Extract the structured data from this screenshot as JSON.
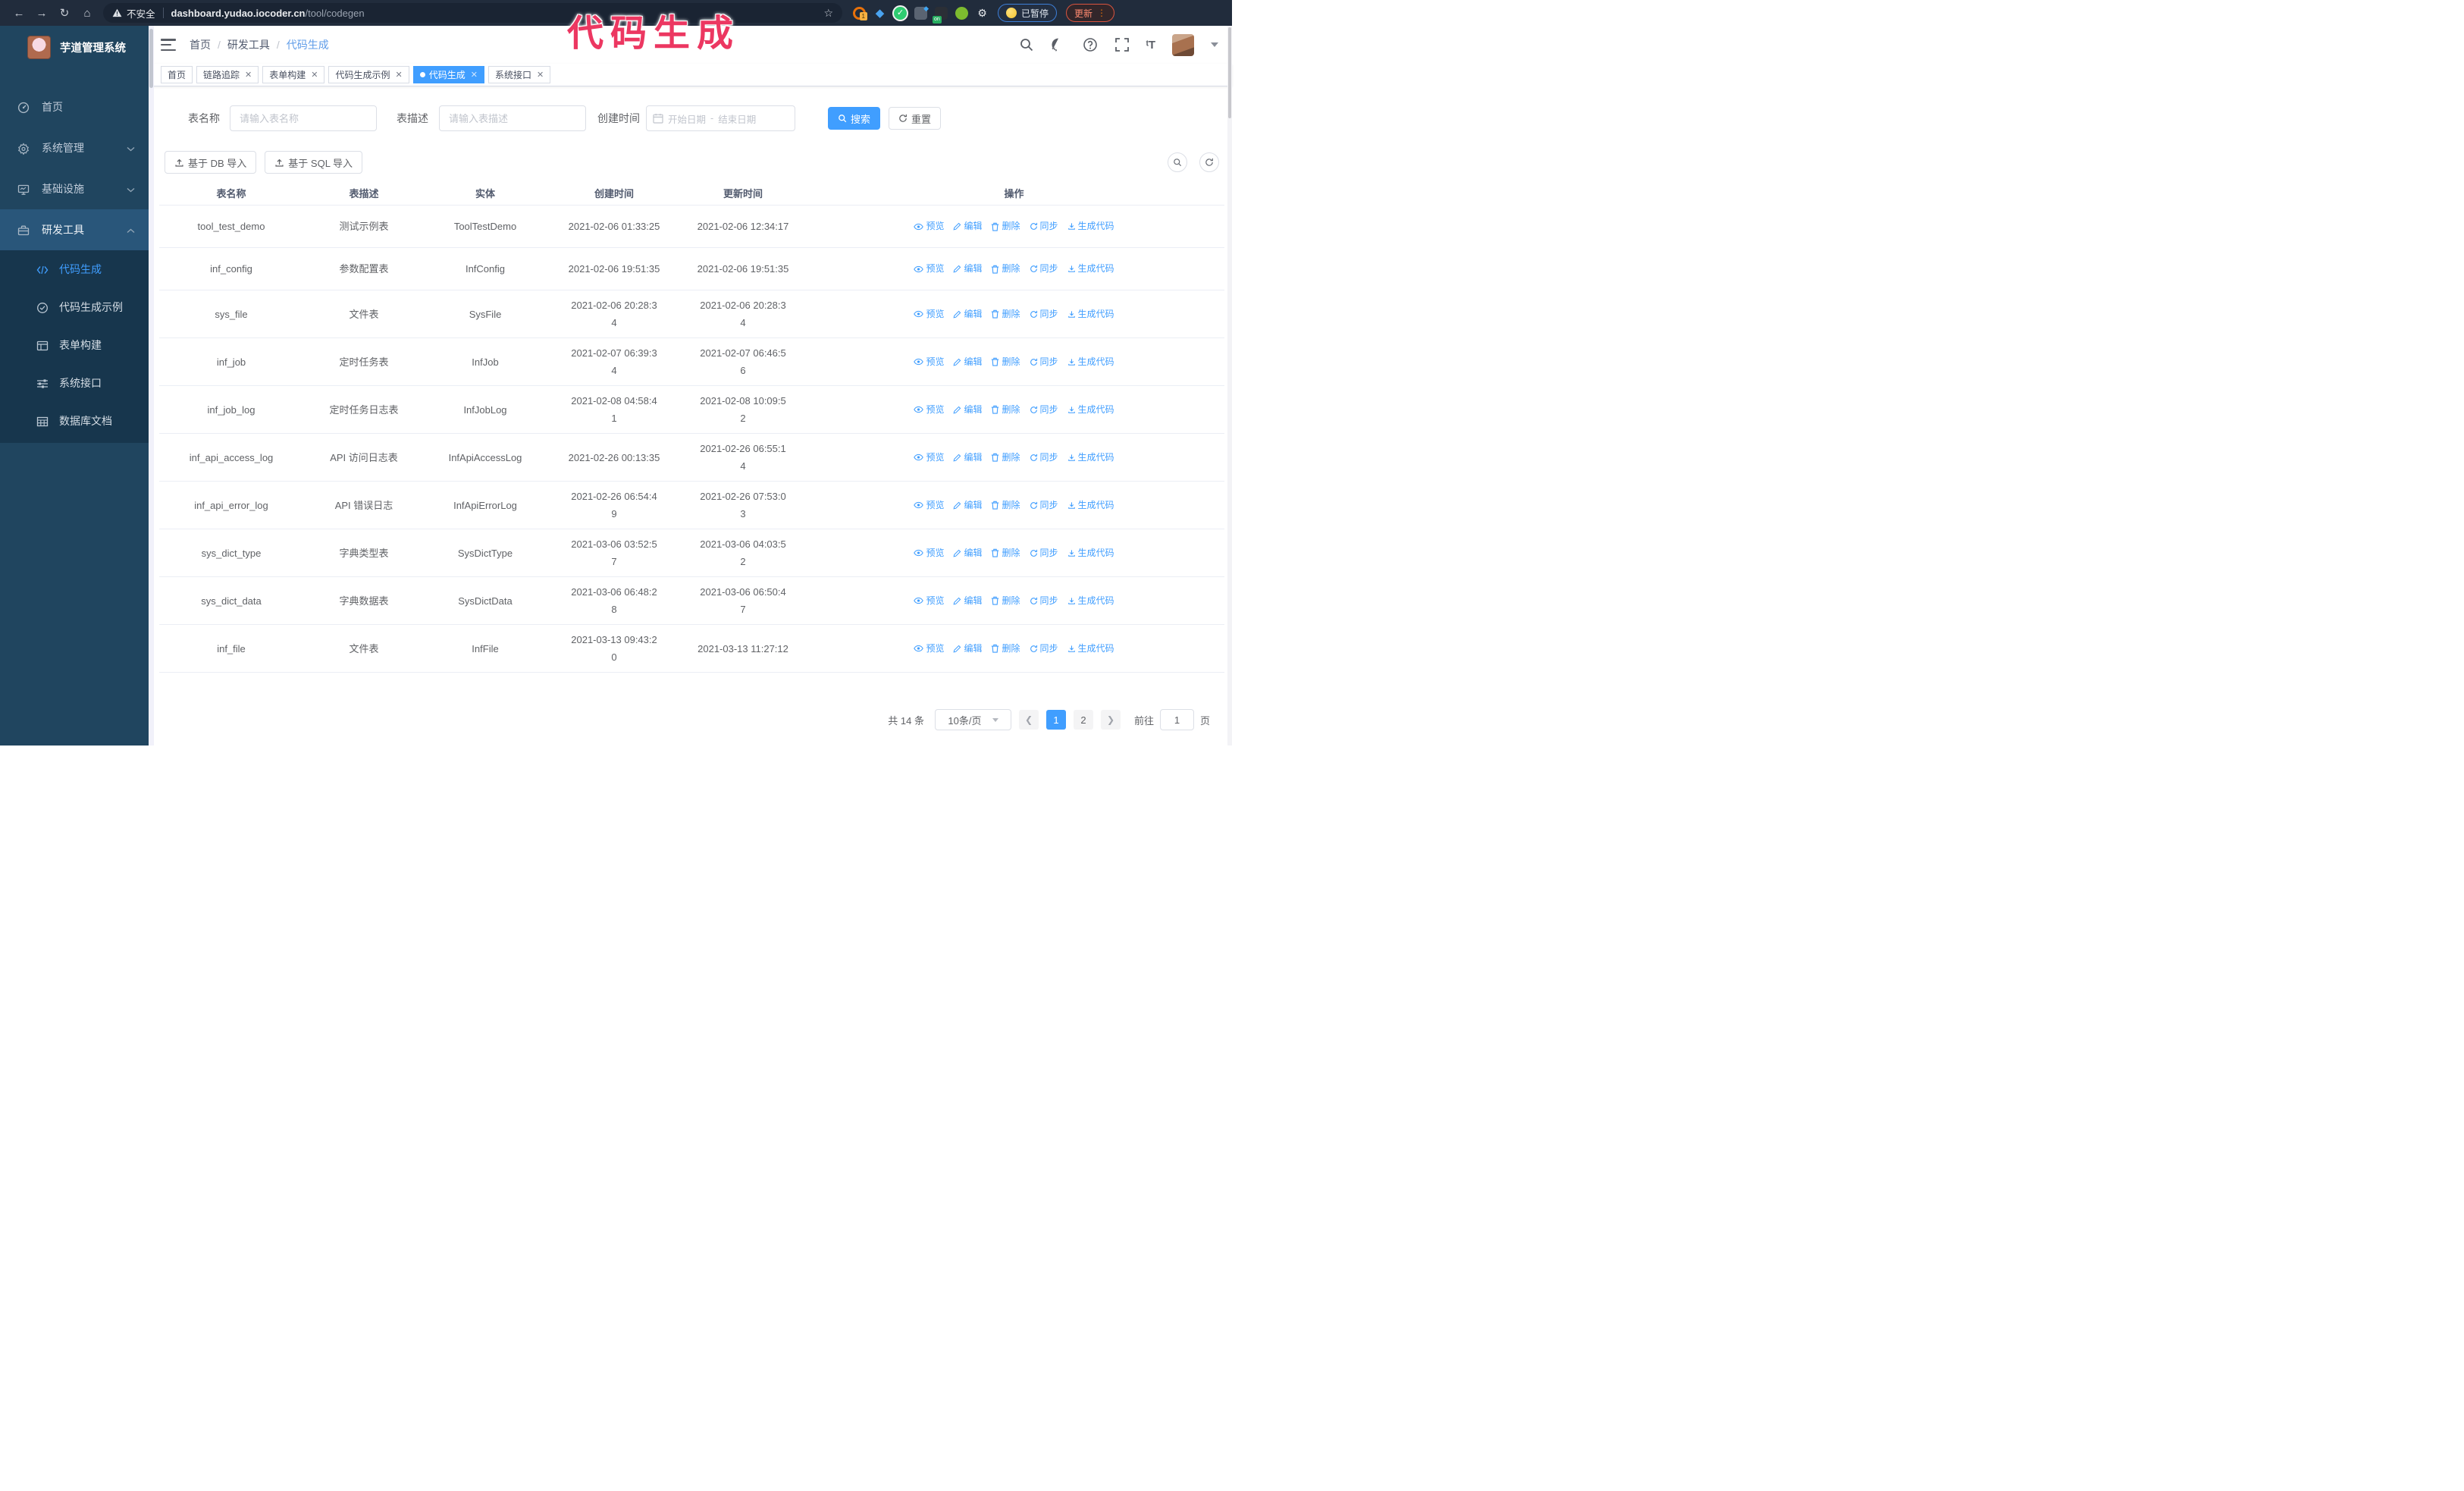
{
  "colors": {
    "accent": "#409eff",
    "overlay_title": "#ec3761",
    "sidebar_bg": "#20455f",
    "submenu_bg": "#17364d"
  },
  "overlay": {
    "title": "代码生成"
  },
  "browser": {
    "security_label": "不安全",
    "url_host": "dashboard.yudao.iocoder.cn",
    "url_path": "/tool/codegen",
    "ext_badge": "1",
    "on_badge": "on",
    "paused_label": "已暂停",
    "update_label": "更新"
  },
  "sidebar": {
    "app_title": "芋道管理系统",
    "items": [
      {
        "label": "首页",
        "icon": "dashboard-icon",
        "arrow": "none",
        "expanded": false
      },
      {
        "label": "系统管理",
        "icon": "gear-icon",
        "arrow": "down",
        "expanded": false
      },
      {
        "label": "基础设施",
        "icon": "monitor-icon",
        "arrow": "down",
        "expanded": false
      },
      {
        "label": "研发工具",
        "icon": "toolbox-icon",
        "arrow": "up",
        "expanded": true
      }
    ],
    "submenu": [
      {
        "label": "代码生成",
        "icon": "code-icon",
        "active": true
      },
      {
        "label": "代码生成示例",
        "icon": "example-icon",
        "active": false
      },
      {
        "label": "表单构建",
        "icon": "form-icon",
        "active": false
      },
      {
        "label": "系统接口",
        "icon": "api-icon",
        "active": false
      },
      {
        "label": "数据库文档",
        "icon": "database-icon",
        "active": false
      }
    ]
  },
  "header": {
    "breadcrumb": [
      "首页",
      "研发工具",
      "代码生成"
    ]
  },
  "tabs": [
    {
      "label": "首页",
      "closable": false,
      "active": false
    },
    {
      "label": "链路追踪",
      "closable": true,
      "active": false
    },
    {
      "label": "表单构建",
      "closable": true,
      "active": false
    },
    {
      "label": "代码生成示例",
      "closable": true,
      "active": false
    },
    {
      "label": "代码生成",
      "closable": true,
      "active": true
    },
    {
      "label": "系统接口",
      "closable": true,
      "active": false
    }
  ],
  "filter": {
    "name_label": "表名称",
    "name_placeholder": "请输入表名称",
    "desc_label": "表描述",
    "desc_placeholder": "请输入表描述",
    "time_label": "创建时间",
    "start_placeholder": "开始日期",
    "range_separator": "-",
    "end_placeholder": "结束日期",
    "search_label": "搜索",
    "reset_label": "重置"
  },
  "toolbar": {
    "db_import_label": "基于 DB 导入",
    "sql_import_label": "基于 SQL 导入"
  },
  "table": {
    "columns": [
      "表名称",
      "表描述",
      "实体",
      "创建时间",
      "更新时间",
      "操作"
    ],
    "actions": [
      "预览",
      "编辑",
      "删除",
      "同步",
      "生成代码"
    ],
    "rows": [
      {
        "name": "tool_test_demo",
        "desc": "测试示例表",
        "entity": "ToolTestDemo",
        "created": "2021-02-06 01:33:25",
        "updated": "2021-02-06 12:34:17"
      },
      {
        "name": "inf_config",
        "desc": "参数配置表",
        "entity": "InfConfig",
        "created": "2021-02-06 19:51:35",
        "updated": "2021-02-06 19:51:35"
      },
      {
        "name": "sys_file",
        "desc": "文件表",
        "entity": "SysFile",
        "created": "2021-02-06 20:28:3\n4",
        "updated": "2021-02-06 20:28:3\n4"
      },
      {
        "name": "inf_job",
        "desc": "定时任务表",
        "entity": "InfJob",
        "created": "2021-02-07 06:39:3\n4",
        "updated": "2021-02-07 06:46:5\n6"
      },
      {
        "name": "inf_job_log",
        "desc": "定时任务日志表",
        "entity": "InfJobLog",
        "created": "2021-02-08 04:58:4\n1",
        "updated": "2021-02-08 10:09:5\n2"
      },
      {
        "name": "inf_api_access_log",
        "desc": "API 访问日志表",
        "entity": "InfApiAccessLog",
        "created": "2021-02-26 00:13:35",
        "updated": "2021-02-26 06:55:1\n4"
      },
      {
        "name": "inf_api_error_log",
        "desc": "API 错误日志",
        "entity": "InfApiErrorLog",
        "created": "2021-02-26 06:54:4\n9",
        "updated": "2021-02-26 07:53:0\n3"
      },
      {
        "name": "sys_dict_type",
        "desc": "字典类型表",
        "entity": "SysDictType",
        "created": "2021-03-06 03:52:5\n7",
        "updated": "2021-03-06 04:03:5\n2"
      },
      {
        "name": "sys_dict_data",
        "desc": "字典数据表",
        "entity": "SysDictData",
        "created": "2021-03-06 06:48:2\n8",
        "updated": "2021-03-06 06:50:4\n7"
      },
      {
        "name": "inf_file",
        "desc": "文件表",
        "entity": "InfFile",
        "created": "2021-03-13 09:43:2\n0",
        "updated": "2021-03-13 11:27:12"
      }
    ]
  },
  "pagination": {
    "total_label": "共 14 条",
    "page_size_label": "10条/页",
    "pages": [
      "1",
      "2"
    ],
    "active_page": "1",
    "goto_label": "前往",
    "goto_value": "1",
    "page_suffix": "页"
  }
}
